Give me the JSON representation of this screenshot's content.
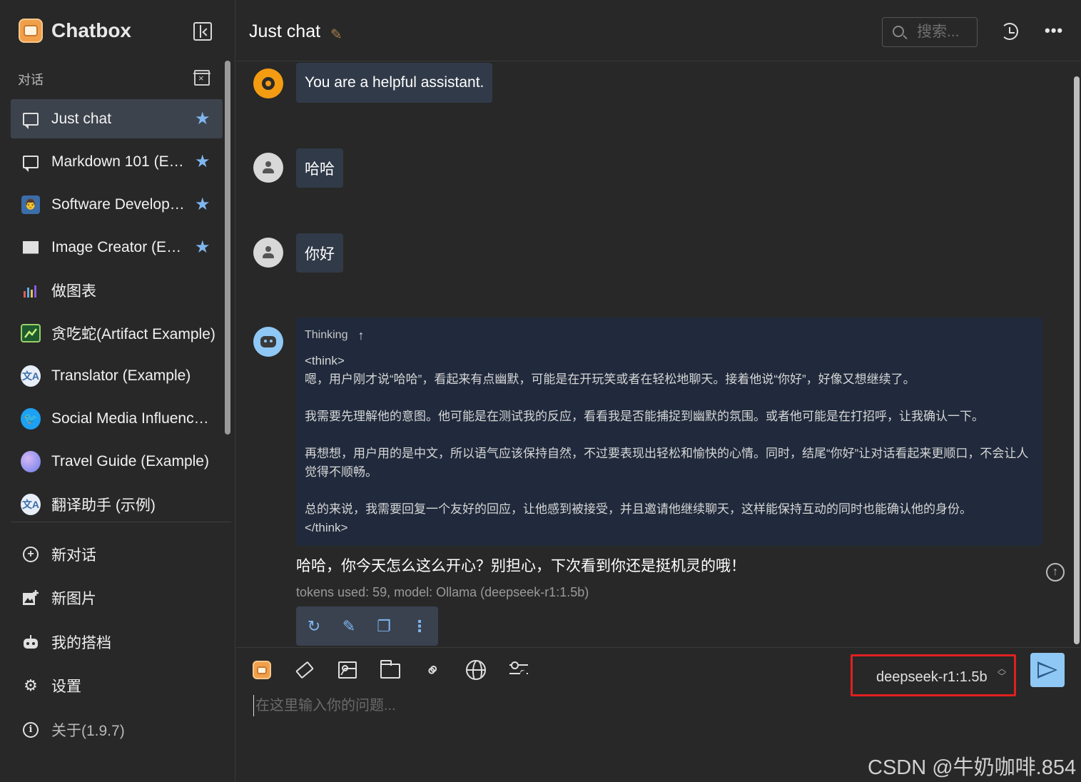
{
  "app": {
    "name": "Chatbox"
  },
  "sidebar": {
    "section_label": "对话",
    "sessions": [
      {
        "label": "Just chat",
        "starred": true,
        "active": true,
        "icon": "chat-bubble-icon"
      },
      {
        "label": "Markdown 101 (Example)",
        "starred": true,
        "active": false,
        "icon": "chat-bubble-icon"
      },
      {
        "label": "Software Developer (Example)",
        "starred": true,
        "active": false,
        "icon": "developer-avatar-icon"
      },
      {
        "label": "Image Creator (Example)",
        "starred": true,
        "active": false,
        "icon": "image-icon"
      },
      {
        "label": "做图表",
        "starred": false,
        "active": false,
        "icon": "chart-avatar-icon"
      },
      {
        "label": "贪吃蛇(Artifact Example)",
        "starred": false,
        "active": false,
        "icon": "snake-avatar-icon"
      },
      {
        "label": "Translator (Example)",
        "starred": false,
        "active": false,
        "icon": "translator-avatar-icon"
      },
      {
        "label": "Social Media Influencer (Example)",
        "starred": false,
        "active": false,
        "icon": "twitter-avatar-icon"
      },
      {
        "label": "Travel Guide (Example)",
        "starred": false,
        "active": false,
        "icon": "globe-avatar-icon"
      },
      {
        "label": "翻译助手 (示例)",
        "starred": false,
        "active": false,
        "icon": "translator-avatar-icon"
      }
    ],
    "menu": [
      {
        "label": "新对话",
        "icon": "plus-circle-icon"
      },
      {
        "label": "新图片",
        "icon": "add-image-icon"
      },
      {
        "label": "我的搭档",
        "icon": "robot-icon"
      },
      {
        "label": "设置",
        "icon": "gear-icon"
      },
      {
        "label": "关于(1.9.7)",
        "icon": "info-icon"
      }
    ]
  },
  "header": {
    "title": "Just chat",
    "search_placeholder": "搜索..."
  },
  "messages": {
    "system": "You are a helpful assistant.",
    "user_1": "哈哈",
    "user_2": "你好",
    "thinking_label": "Thinking",
    "think_open": "<think>",
    "think_p1": "嗯，用户刚才说“哈哈”，看起来有点幽默，可能是在开玩笑或者在轻松地聊天。接着他说“你好”，好像又想继续了。",
    "think_p2": "我需要先理解他的意图。他可能是在测试我的反应，看看我是否能捕捉到幽默的氛围。或者他可能是在打招呼，让我确认一下。",
    "think_p3": "再想想，用户用的是中文，所以语气应该保持自然，不过要表现出轻松和愉快的心情。同时，结尾“你好”让对话看起来更顺口，不会让人觉得不顺畅。",
    "think_p4": "总的来说，我需要回复一个友好的回应，让他感到被接受，并且邀请他继续聊天，这样能保持互动的同时也能确认他的身份。",
    "think_close": "</think>",
    "answer": "哈哈，你今天怎么这么开心？别担心，下次看到你还是挺机灵的哦！",
    "meta": "tokens used: 59, model: Ollama (deepseek-r1:1.5b)"
  },
  "composer": {
    "model": "deepseek-r1:1.5b",
    "placeholder": "在这里输入你的问题..."
  },
  "watermark": "CSDN @牛奶咖啡.854",
  "colors": {
    "background": "#282828",
    "bubble": "#313a48",
    "think_bg": "#202a3c",
    "accent": "#8fc8f5",
    "star": "#7fb6ef",
    "highlight_box": "#e02020"
  }
}
